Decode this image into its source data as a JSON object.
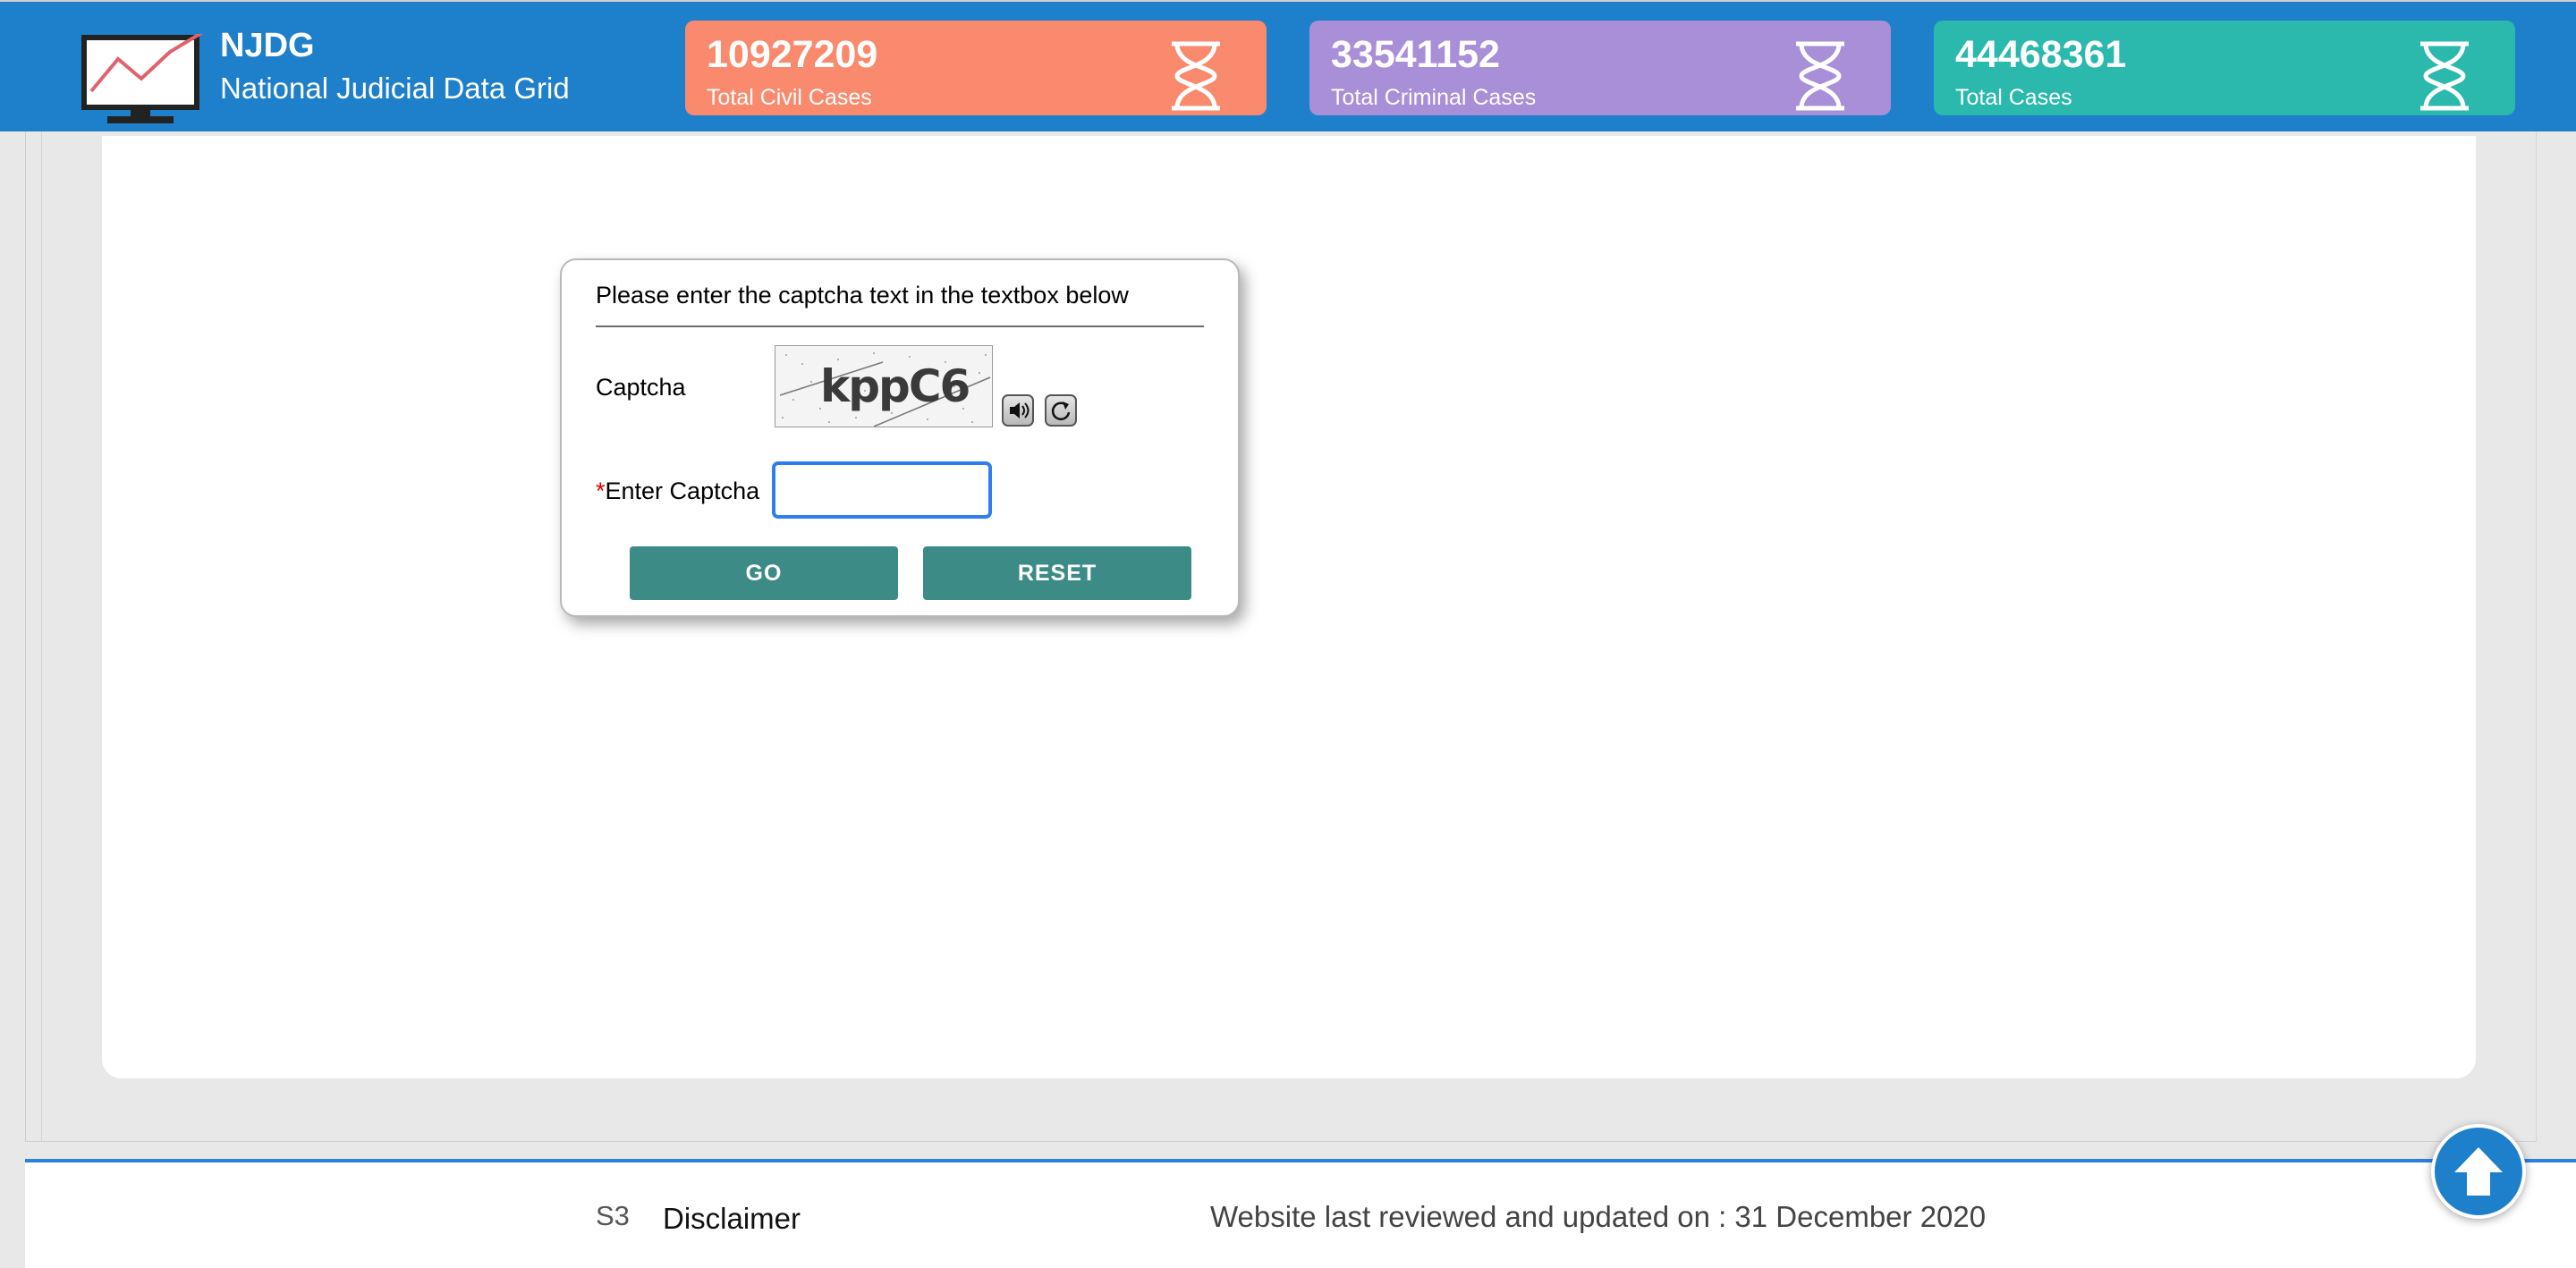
{
  "header": {
    "logo_icon": "monitor-chart-icon",
    "title": "NJDG",
    "subtitle": "National Judicial Data Grid",
    "stats": [
      {
        "value": "10927209",
        "label": "Total Civil Cases",
        "color": "#f98a6d",
        "icon": "hourglass-icon"
      },
      {
        "value": "33541152",
        "label": "Total Criminal Cases",
        "color": "#a98ed8",
        "icon": "hourglass-icon"
      },
      {
        "value": "44468361",
        "label": "Total Cases",
        "color": "#2ab9ac",
        "icon": "hourglass-icon"
      }
    ]
  },
  "dialog": {
    "instruction": "Please enter the captcha text in the textbox below",
    "captcha_label": "Captcha",
    "captcha_text": "kppC6",
    "audio_icon": "speaker-icon",
    "refresh_icon": "refresh-icon",
    "required_marker": "*",
    "enter_label": "Enter Captcha",
    "input_value": "",
    "go_label": "GO",
    "reset_label": "RESET",
    "button_color": "#3d8b87"
  },
  "footer": {
    "s3": "S3",
    "disclaimer": "Disclaimer",
    "updated": "Website last reviewed and updated on : 31 December 2020"
  },
  "scroll_top_icon": "arrow-up-icon"
}
